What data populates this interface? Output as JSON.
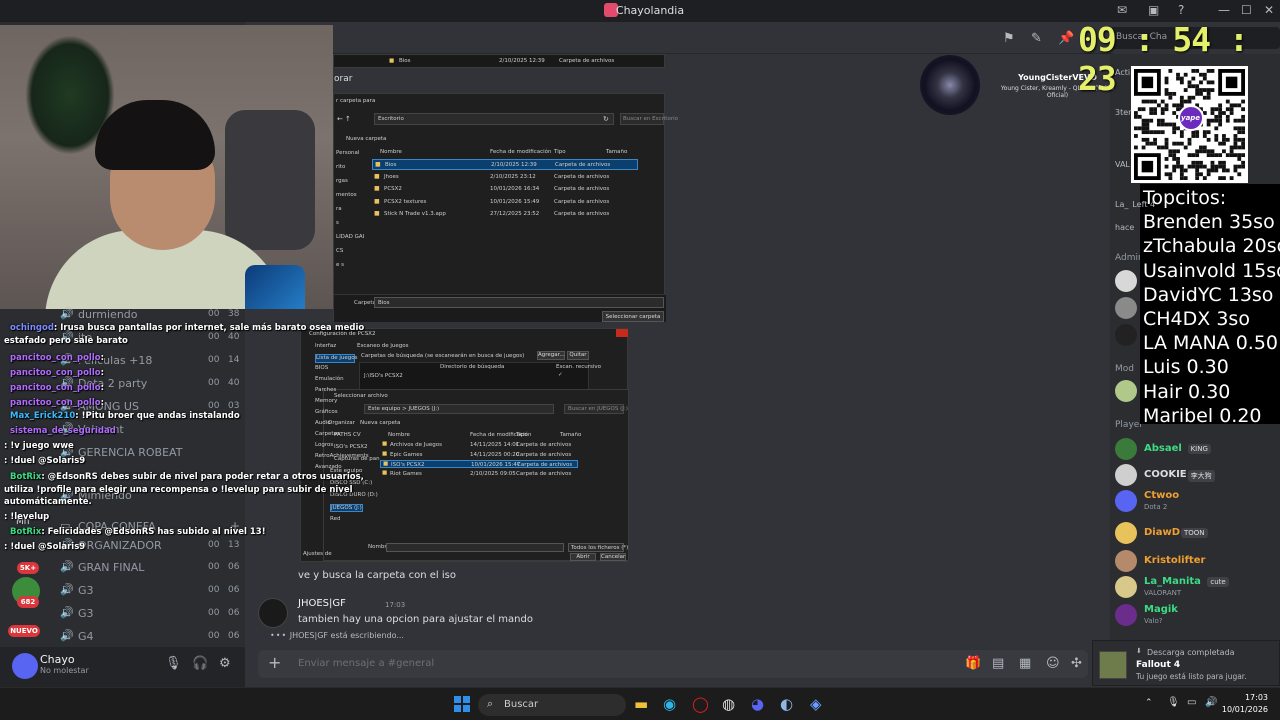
{
  "window": {
    "title": "Chayolandia"
  },
  "header_search_placeholder": "Buscar Cha",
  "sidebar": {
    "channels": [
      {
        "name": "durmiendo",
        "n1": "00",
        "n2": "38",
        "icon": "speaker-icon"
      },
      {
        "name": "ite",
        "n1": "00",
        "n2": "40",
        "icon": "speaker-icon"
      },
      {
        "name": "Peliculas +18",
        "n1": "00",
        "n2": "14",
        "icon": "speaker-icon"
      },
      {
        "name": "Dota 2 party",
        "n1": "00",
        "n2": "40",
        "icon": "speaker-icon"
      },
      {
        "name": "AMONG US",
        "n1": "00",
        "n2": "03",
        "icon": "speaker-icon"
      },
      {
        "name": "Valorant",
        "n1": "",
        "n2": "",
        "icon": "speaker-icon"
      },
      {
        "name": "GERENCIA ROBEAT",
        "n1": "",
        "n2": "",
        "icon": "speaker-icon"
      },
      {
        "name": "Mimiendo",
        "n1": "",
        "n2": "",
        "icon": "speaker-icon"
      },
      {
        "name": "COPA CONEFA",
        "n1": "",
        "n2": "",
        "icon": "folder-icon"
      },
      {
        "name": "ORGANIZADOR",
        "n1": "00",
        "n2": "13",
        "icon": "speaker-icon"
      },
      {
        "name": "GRAN FINAL",
        "n1": "00",
        "n2": "06",
        "icon": "speaker-icon"
      },
      {
        "name": "G3",
        "n1": "00",
        "n2": "06",
        "icon": "speaker-icon"
      },
      {
        "name": "G3",
        "n1": "00",
        "n2": "06",
        "icon": "speaker-icon"
      },
      {
        "name": "G4",
        "n1": "00",
        "n2": "06",
        "icon": "speaker-icon"
      }
    ],
    "badges": [
      "5K+",
      "682",
      "NUEVO"
    ],
    "category_label": "Mn"
  },
  "user": {
    "name": "Chayo",
    "status": "No molestar"
  },
  "chat_overlay": [
    {
      "name": "ochingod",
      "text": ": Irusa busca pantallas por internet, sale más barato osea medio",
      "color": "#7b8cff"
    },
    {
      "name": "",
      "text": "estafado pero sale barato",
      "color": "#7b8cff"
    },
    {
      "name": "pancitoo_con_pollo",
      "text": ":",
      "color": "#b06bff"
    },
    {
      "name": "pancitoo_con_pollo",
      "text": ":",
      "color": "#b06bff"
    },
    {
      "name": "pancitoo_con_pollo",
      "text": ":",
      "color": "#b06bff"
    },
    {
      "name": "pancitoo_con_pollo",
      "text": ":",
      "color": "#b06bff"
    },
    {
      "name": "Max_Erick210",
      "text": ": !Pitu broer que andas instalando",
      "color": "#3dbbff"
    },
    {
      "name": "sistema_de_seguridad",
      "text": "",
      "color": "#b06bff"
    },
    {
      "name": "",
      "text": ": !v juego wwe",
      "color": "#ffffff"
    },
    {
      "name": "",
      "text": ": !duel @Solaris9",
      "color": "#ffffff"
    },
    {
      "name": "BotRix",
      "text": ": @EdsonRS debes subir de nivel para poder retar a otros usuarios,",
      "color": "#3ddc84"
    },
    {
      "name": "",
      "text": "utiliza !profile para elegir una recompensa o !levelup para subir de nivel",
      "color": "#ffffff"
    },
    {
      "name": "",
      "text": "automáticamente.",
      "color": "#ffffff"
    },
    {
      "name": "",
      "text": ": !levelup",
      "color": "#ffffff"
    },
    {
      "name": "BotRix",
      "text": ": Felicidades @EdsonRS has subido al nivel 13!",
      "color": "#3ddc84"
    },
    {
      "name": "",
      "text": ": !duel @Solaris9",
      "color": "#ffffff"
    }
  ],
  "shared_screen": {
    "top_folder": {
      "name": "Bios",
      "date": "2/10/2025 12:39",
      "type": "Carpeta de archivos"
    },
    "partial_label": "orar",
    "dialog1": {
      "title": "r carpeta para",
      "path": "Escritorio",
      "search": "Buscar en Escritorio",
      "new_folder": "Nueva carpeta",
      "nav": [
        "Personal",
        "rito",
        "rgas",
        "mentos",
        "ra",
        "s",
        "LIDAD GAI",
        "CS",
        "e s"
      ],
      "columns": [
        "Nombre",
        "Fecha de modificación",
        "Tipo",
        "Tamaño"
      ],
      "rows": [
        {
          "name": "Bios",
          "date": "2/10/2025 12:39",
          "type": "Carpeta de archivos"
        },
        {
          "name": "Jhoes",
          "date": "2/10/2025 23:12",
          "type": "Carpeta de archivos"
        },
        {
          "name": "PCSX2",
          "date": "10/01/2026 16:34",
          "type": "Carpeta de archivos"
        },
        {
          "name": "PCSX2 textures",
          "date": "10/01/2026 15:49",
          "type": "Carpeta de archivos"
        },
        {
          "name": "Stick N Trade v1.3.app",
          "date": "27/12/2025 23:52",
          "type": "Carpeta de archivos"
        }
      ],
      "folder_label": "Carpeta:",
      "folder_value": "Bios",
      "select_button": "Seleccionar carpeta"
    },
    "dialog2": {
      "title": "Configuración de PCSX2",
      "nav": [
        "Interfaz",
        "Lista de juegos",
        "BIOS",
        "Emulación",
        "Parches",
        "Memory",
        "Gráficos",
        "Audio",
        "Carpetas",
        "Logros",
        "RetroAchievements",
        "Avanzado"
      ],
      "section": "Carpetas de búsqueda (se escanearán en busca de juegos)",
      "section2": "Escaneo de juegos",
      "col_dir": "Directorio de búsqueda",
      "col_rec": "Escan. recursivo",
      "entry": "J:\\ISO's PCSX2",
      "add_btn": "Agregar...",
      "remove_btn": "Quitar",
      "subdlg_title": "Seleccionar archivo",
      "subdlg_path": "Este equipo > JUEGOS (J:)",
      "subdlg_search": "Buscar en JUEGOS (J:)",
      "organize": "Organizar",
      "new_folder": "Nueva carpeta",
      "tree": [
        "PATHS CV",
        "ISO's PCSX2",
        "Capturas de pan",
        "Este equipo",
        "DISCO SSD (C:)",
        "DISCO DURO (D:)",
        "JUEGOS (J:)",
        "Red"
      ],
      "columns": [
        "Nombre",
        "Fecha de modificación",
        "Tipo",
        "Tamaño"
      ],
      "rows": [
        {
          "name": "Archivos de Juegos",
          "date": "14/11/2025 14:01",
          "type": "Carpeta de archivos"
        },
        {
          "name": "Epic Games",
          "date": "14/11/2025 00:20",
          "type": "Carpeta de archivos"
        },
        {
          "name": "ISO's PCSX2",
          "date": "10/01/2026 15:47",
          "type": "Carpeta de archivos"
        },
        {
          "name": "Riot Games",
          "date": "2/10/2025 09:05",
          "type": "Carpeta de archivos"
        }
      ],
      "name_label": "Nombre:",
      "filter": "Todos los ficheros (*)",
      "open_btn": "Abrir",
      "cancel_btn": "Cancelar",
      "footer_left": "Ajustes de"
    }
  },
  "messages": {
    "line1": "ve y busca la carpeta con el iso",
    "author": "JHOES|GF",
    "time": "17:03",
    "line2": "tambien hay una opcion para ajustar el mando",
    "typing": "JHOES|GF está escribiendo..."
  },
  "composer": {
    "placeholder": "Enviar mensaje a #general"
  },
  "now_playing": {
    "artist": "YoungCisterVEVO",
    "title": "Young Cister, Kreamly - QLOO* (Video Oficial)"
  },
  "clock": {
    "hh": "09",
    "mm": "54",
    "ss": "23"
  },
  "qr": {
    "label": "yape"
  },
  "topcitos": {
    "title": "Topcitos:",
    "entries": [
      "Brenden 35so",
      "zTchabula 20so",
      "Usainvold 15so",
      "DavidYC 13so",
      "CH4DX 3so",
      "LA MANA 0.50",
      "Luis 0.30",
      "Hair 0.30",
      "Maribel 0.20"
    ]
  },
  "members": {
    "partial_top": [
      {
        "name": "Acti",
        "sub": ""
      },
      {
        "name": "3ter",
        "sub": ""
      },
      {
        "name": "VAL",
        "sub": ""
      },
      {
        "name": "La_",
        "sub": "Left 4"
      },
      {
        "name": "hace",
        "sub": ""
      }
    ],
    "sections": {
      "admin": "Admin",
      "mod": "Mod",
      "player": "Player"
    },
    "players": [
      {
        "name": "Absael",
        "tag": "KING",
        "sub": "",
        "color": "#3ddc84"
      },
      {
        "name": "COOKIE",
        "tag": "李大狗",
        "sub": "",
        "color": "#dbdee1"
      },
      {
        "name": "Ctwoo",
        "tag": "",
        "sub": "Dota 2",
        "color": "#f0a030"
      },
      {
        "name": "DiawD",
        "tag": "TOON",
        "sub": "",
        "color": "#f0a030"
      },
      {
        "name": "Kristolifter",
        "tag": "",
        "sub": "",
        "color": "#f0a030"
      },
      {
        "name": "La_Manita",
        "tag": "cute",
        "sub": "VALORANT",
        "color": "#3ddc84"
      },
      {
        "name": "Magik",
        "tag": "",
        "sub": "Valo?",
        "color": "#3ddc84"
      }
    ]
  },
  "notification": {
    "title": "Descarga completada",
    "game": "Fallout 4",
    "body": "Tu juego está listo para jugar."
  },
  "taskbar": {
    "search": "Buscar",
    "time": "17:03",
    "date": "10/01/2026"
  }
}
